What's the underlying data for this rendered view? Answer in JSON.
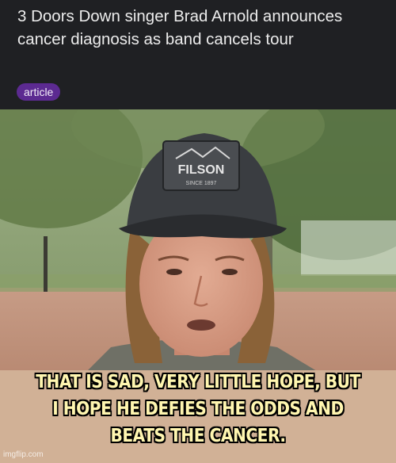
{
  "article": {
    "headline": "3 Doors Down singer Brad Arnold announces cancer diagnosis as band cancels tour",
    "tag": "article"
  },
  "photo": {
    "cap_logo_text": "FILSON",
    "cap_logo_subtext": "SINCE 1897"
  },
  "meme": {
    "caption": "THAT IS SAD, VERY LITTLE HOPE, BUT I HOPE HE DEFIES THE ODDS AND BEATS THE CANCER.",
    "watermark": "imgflip.com"
  },
  "colors": {
    "header_bg": "#1f2023",
    "tag_bg": "#5c2a91",
    "caption_band": "#d1b196",
    "caption_text": "#fff6b0"
  }
}
